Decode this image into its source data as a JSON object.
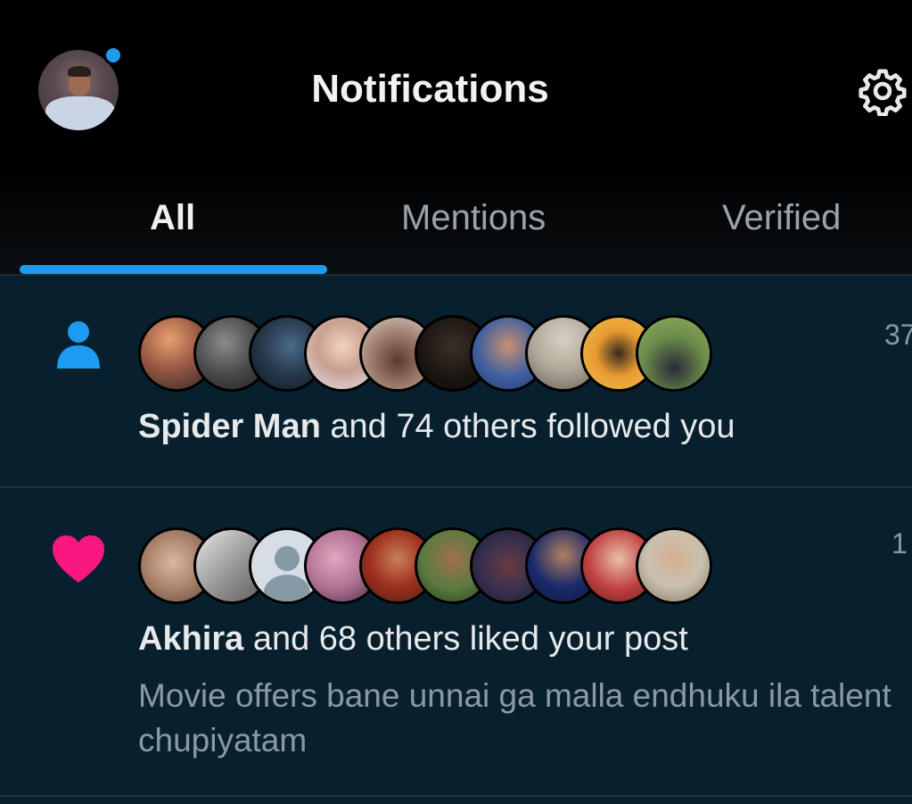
{
  "header": {
    "title": "Notifications",
    "settings_icon": "gear-icon",
    "has_unread_dot": true,
    "accent_color": "#1d9bf0"
  },
  "tabs": [
    {
      "label": "All",
      "selected": true
    },
    {
      "label": "Mentions",
      "selected": false
    },
    {
      "label": "Verified",
      "selected": false
    }
  ],
  "notifications": [
    {
      "type": "follow",
      "icon": "person-icon",
      "icon_color": "#1d9bf0",
      "actor": "Spider Man",
      "rest": " and 74 others followed you",
      "timestamp": "37",
      "avatar_count": 11
    },
    {
      "type": "like",
      "icon": "heart-icon",
      "icon_color": "#f91880",
      "actor": "Akhira",
      "rest": " and 68 others liked your post",
      "timestamp": "1",
      "preview": "Movie offers bane unnai ga malla endhuku ila talent chupiyatam",
      "avatar_count": 11
    }
  ]
}
